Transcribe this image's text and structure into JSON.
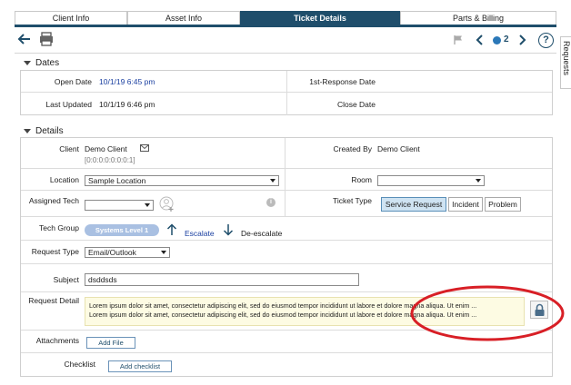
{
  "tabs": [
    "Client Info",
    "Asset Info",
    "Ticket Details",
    "Parts & Billing"
  ],
  "drawer_label": "Requests",
  "toolbar": {
    "count": "2"
  },
  "dates": {
    "heading": "Dates",
    "open_date_label": "Open Date",
    "open_date_value": "10/1/19 6:45 pm",
    "first_response_label": "1st-Response Date",
    "first_response_value": "",
    "last_updated_label": "Last Updated",
    "last_updated_value": "10/1/19 6:46 pm",
    "close_date_label": "Close Date",
    "close_date_value": ""
  },
  "details": {
    "heading": "Details",
    "client_label": "Client",
    "client_name": "Demo Client",
    "client_id": "[0:0:0:0:0:0:0:1]",
    "created_by_label": "Created By",
    "created_by_value": "Demo Client",
    "location_label": "Location",
    "location_value": "Sample Location",
    "room_label": "Room",
    "room_value": "",
    "assigned_tech_label": "Assigned Tech",
    "assigned_tech_value": "",
    "ticket_type_label": "Ticket Type",
    "ticket_types": [
      "Service Request",
      "Incident",
      "Problem"
    ],
    "ticket_type_selected": "Service Request",
    "tech_group_label": "Tech Group",
    "tech_group_value": "Systems  Level 1",
    "escalate_label": "Escalate",
    "deescalate_label": "De-escalate",
    "request_type_label": "Request Type",
    "request_type_value": "Email/Outlook",
    "subject_label": "Subject",
    "subject_value": "dsddsds",
    "request_detail_label": "Request Detail",
    "request_detail_lines": [
      "Lorem ipsum dolor sit amet, consectetur adipiscing elit, sed do eiusmod tempor incididunt ut labore et dolore magna aliqua. Ut enim ...",
      "Lorem ipsum dolor sit amet, consectetur adipiscing elit, sed do eiusmod tempor incididunt ut labore et dolore magna aliqua. Ut enim ..."
    ],
    "attachments_label": "Attachments",
    "add_file_label": "Add File",
    "checklist_label": "Checklist",
    "add_checklist_label": "Add checklist"
  },
  "colors": {
    "accent": "#1f4e6b",
    "link": "#1a3fa0",
    "annotation": "#d81f26"
  }
}
